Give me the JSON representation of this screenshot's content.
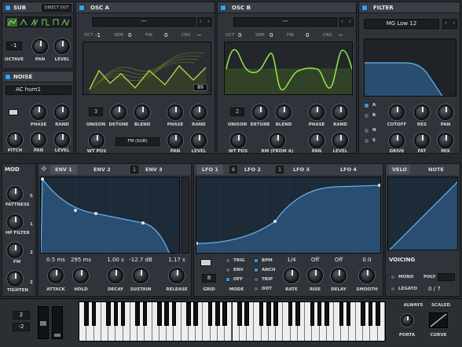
{
  "sub": {
    "title": "SUB",
    "direct_out": "DIRECT OUT",
    "octave_value": "-1",
    "labels": {
      "octave": "OCTAVE",
      "pan": "PAN",
      "level": "LEVEL"
    }
  },
  "noise": {
    "title": "NOISE",
    "preset": "AC hum1",
    "labels": {
      "phase": "PHASE",
      "rand": "RAND",
      "pitch": "PITCH",
      "pan": "PAN",
      "level": "LEVEL"
    }
  },
  "osc_a": {
    "title": "OSC A",
    "wavetable": "---",
    "oct_label": "OCT",
    "oct": "-1",
    "sem_label": "SEM",
    "sem": "0",
    "fin_label": "FIN",
    "fin": "0",
    "crs_label": "CRS",
    "crs": "--",
    "frame": "89",
    "unison": "3",
    "labels": {
      "unison": "UNISON",
      "detune": "DETUNE",
      "blend": "BLEND",
      "phase": "PHASE",
      "rand": "RAND",
      "wt_pos": "WT POS",
      "fm": "FM (SUB)",
      "pan": "PAN",
      "level": "LEVEL"
    }
  },
  "osc_b": {
    "title": "OSC B",
    "wavetable": "---",
    "oct_label": "OCT",
    "oct": "0",
    "sem_label": "SEM",
    "sem": "0",
    "fin_label": "FIN",
    "fin": "0",
    "crs_label": "CRS",
    "crs": "--",
    "unison": "2",
    "labels": {
      "unison": "UNISON",
      "detune": "DETUNE",
      "blend": "BLEND",
      "phase": "PHASE",
      "rand": "RAND",
      "wt_pos": "WT POS",
      "rm": "RM (FROM A)",
      "pan": "PAN",
      "level": "LEVEL"
    }
  },
  "filter": {
    "title": "FILTER",
    "type": "MG Low 12",
    "routes": [
      "A",
      "B",
      "N",
      "S"
    ],
    "labels": {
      "cutoff": "CUTOFF",
      "res": "RES",
      "pan": "PAN",
      "drive": "DRIVE",
      "fat": "FAT",
      "mix": "MIX"
    }
  },
  "mod": {
    "title": "MOD",
    "items": [
      {
        "label": "FATTNESS",
        "count": "5"
      },
      {
        "label": "HP FILTER",
        "count": "1"
      },
      {
        "label": "FM",
        "count": "2"
      },
      {
        "label": "TIGHTEN",
        "count": "2"
      }
    ]
  },
  "env": {
    "tabs": [
      "ENV 1",
      "ENV 2",
      "1",
      "ENV 3"
    ],
    "values": {
      "attack": "0.5 ms",
      "hold": "295 ms",
      "decay": "1.00 s",
      "sustain": "-12.7 dB",
      "release": "1.17 s"
    },
    "labels": {
      "attack": "ATTACK",
      "hold": "HOLD",
      "decay": "DECAY",
      "sustain": "SUSTAIN",
      "release": "RELEASE"
    }
  },
  "lfo": {
    "tabs": [
      "LFO 1",
      "6",
      "LFO 2",
      "1",
      "LFO 3",
      "LFO 4"
    ],
    "grid": "8",
    "modes": [
      "TRIG",
      "ENV",
      "OFF"
    ],
    "options": [
      "BPM",
      "ANCH",
      "TRIP",
      "DOT"
    ],
    "values": {
      "rate": "1/4",
      "rise": "Off",
      "delay": "Off",
      "smooth": "0.0"
    },
    "labels": {
      "grid": "GRID",
      "mode": "MODE",
      "rate": "RATE",
      "rise": "RISE",
      "delay": "DELAY",
      "smooth": "SMOOTH"
    }
  },
  "velo": {
    "tabs": [
      "VELO",
      "NOTE"
    ]
  },
  "voicing": {
    "title": "VOICING",
    "mono": "MONO",
    "legato": "LEGATO",
    "poly_label": "POLY",
    "poly_count": "0 / 7"
  },
  "keyboard": {
    "pitch_up": "2",
    "pitch_down": "-2"
  },
  "porta": {
    "always": "ALWAYS",
    "scaled": "SCALED",
    "porta": "PORTA",
    "curve": "CURVE"
  }
}
